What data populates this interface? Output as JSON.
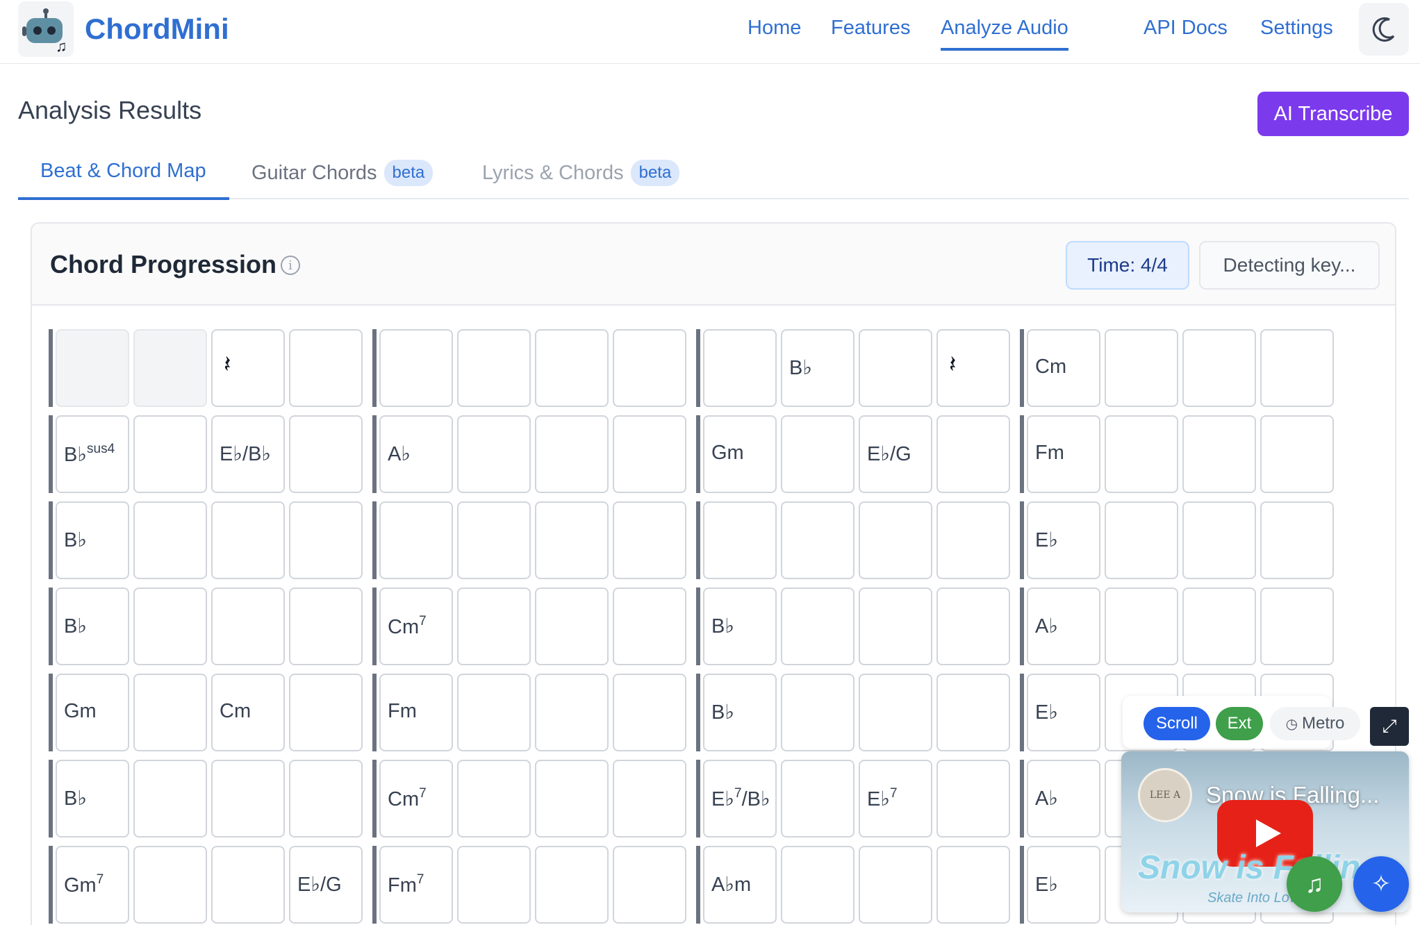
{
  "header": {
    "brand": "ChordMini",
    "nav": [
      {
        "label": "Home",
        "active": false
      },
      {
        "label": "Features",
        "active": false
      },
      {
        "label": "Analyze Audio",
        "active": true
      },
      {
        "label": "API Docs",
        "active": false
      },
      {
        "label": "Settings",
        "active": false
      }
    ],
    "theme_icon": "moon-icon",
    "logo_icon": "robot-logo-icon"
  },
  "page": {
    "title": "Analysis Results",
    "ai_button": "AI Transcribe"
  },
  "tabs": [
    {
      "label": "Beat & Chord Map",
      "badge": "",
      "active": true
    },
    {
      "label": "Guitar Chords",
      "badge": "beta",
      "active": false
    },
    {
      "label": "Lyrics & Chords",
      "badge": "beta",
      "active": false
    }
  ],
  "chord_progression": {
    "title": "Chord Progression",
    "time_signature": "Time: 4/4",
    "key_status": "Detecting key...",
    "rows": [
      [
        [
          "",
          "",
          "𝄽",
          ""
        ],
        [
          "",
          "",
          "",
          ""
        ],
        [
          "",
          "B♭",
          "",
          "𝄽"
        ],
        [
          "Cm",
          "",
          "",
          ""
        ]
      ],
      [
        [
          "B♭|sus4",
          "",
          "E♭/B♭",
          ""
        ],
        [
          "A♭",
          "",
          "",
          ""
        ],
        [
          "Gm",
          "",
          "E♭/G",
          ""
        ],
        [
          "Fm",
          "",
          "",
          ""
        ]
      ],
      [
        [
          "B♭",
          "",
          "",
          ""
        ],
        [
          "",
          "",
          "",
          ""
        ],
        [
          "",
          "",
          "",
          ""
        ],
        [
          "E♭",
          "",
          "",
          ""
        ]
      ],
      [
        [
          "B♭",
          "",
          "",
          ""
        ],
        [
          "Cm|7",
          "",
          "",
          ""
        ],
        [
          "B♭",
          "",
          "",
          ""
        ],
        [
          "A♭",
          "",
          "",
          ""
        ]
      ],
      [
        [
          "Gm",
          "",
          "Cm",
          ""
        ],
        [
          "Fm",
          "",
          "",
          ""
        ],
        [
          "B♭",
          "",
          "",
          ""
        ],
        [
          "E♭",
          "",
          "",
          ""
        ]
      ],
      [
        [
          "B♭",
          "",
          "",
          ""
        ],
        [
          "Cm|7",
          "",
          "",
          ""
        ],
        [
          "E♭|7|/B♭",
          "",
          "E♭|7",
          ""
        ],
        [
          "A♭",
          "",
          "",
          ""
        ]
      ],
      [
        [
          "Gm|7",
          "",
          "",
          "E♭/G"
        ],
        [
          "Fm|7",
          "",
          "",
          ""
        ],
        [
          "A♭m",
          "",
          "",
          ""
        ],
        [
          "E♭",
          "",
          "",
          ""
        ]
      ]
    ],
    "empty_cells": [
      [
        0,
        0,
        0
      ],
      [
        0,
        0,
        1
      ]
    ]
  },
  "floating": {
    "scroll": "Scroll",
    "ext": "Ext",
    "metro": "Metro",
    "video_title": "Snow is Falling...",
    "video_channel_logo": "LEE A",
    "video_art_text": "Snow is Falling",
    "video_tagline": "Skate Into Love"
  },
  "colors": {
    "accent": "#2f6fd1",
    "ai_button": "#7c3aed",
    "scroll_button": "#2563eb",
    "ext_button": "#3f9f4a",
    "youtube_red": "#e62117"
  }
}
